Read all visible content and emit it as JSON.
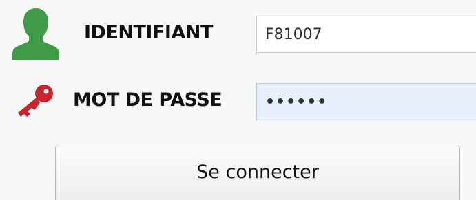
{
  "login": {
    "username_label": "IDENTIFIANT",
    "username_value": "F81007",
    "password_label": "MOT DE PASSE",
    "password_value": "••••••",
    "submit_label": "Se connecter"
  },
  "icons": {
    "user": "user-silhouette-icon",
    "key": "key-icon"
  },
  "colors": {
    "user_icon": "#3f9a49",
    "key_icon": "#c8262f",
    "password_field_bg": "#e8f0fe",
    "background": "#f7f7f7"
  }
}
